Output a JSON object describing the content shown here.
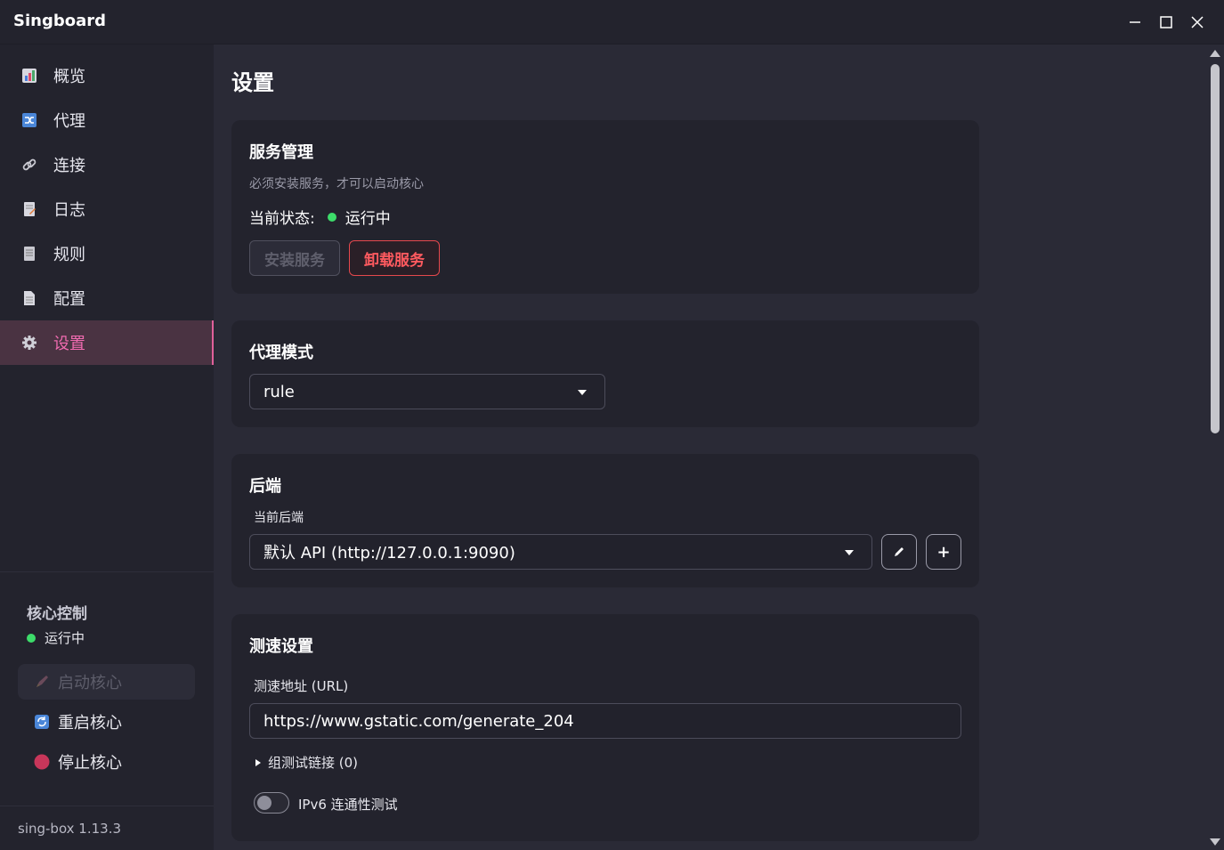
{
  "app": {
    "title": "Singboard"
  },
  "sidebar": {
    "items": [
      {
        "label": "概览",
        "icon": "chart-icon"
      },
      {
        "label": "代理",
        "icon": "shuffle-icon"
      },
      {
        "label": "连接",
        "icon": "link-icon"
      },
      {
        "label": "日志",
        "icon": "log-icon"
      },
      {
        "label": "规则",
        "icon": "rules-icon"
      },
      {
        "label": "配置",
        "icon": "document-icon"
      },
      {
        "label": "设置",
        "icon": "gear-icon",
        "active": true
      }
    ],
    "core": {
      "title": "核心控制",
      "status": "运行中",
      "start_label": "启动核心",
      "restart_label": "重启核心",
      "stop_label": "停止核心"
    },
    "version": "sing-box 1.13.3"
  },
  "main": {
    "title": "设置",
    "service": {
      "title": "服务管理",
      "hint": "必须安装服务，才可以启动核心",
      "status_label": "当前状态:",
      "status_value": "运行中",
      "install_label": "安装服务",
      "uninstall_label": "卸载服务"
    },
    "proxy_mode": {
      "title": "代理模式",
      "selected": "rule"
    },
    "backend": {
      "title": "后端",
      "current_label": "当前后端",
      "selected": "默认 API (http://127.0.0.1:9090)",
      "edit_icon": "pencil-icon",
      "add_label": "+"
    },
    "speedtest": {
      "title": "测速设置",
      "url_label": "测速地址 (URL)",
      "url_value": "https://www.gstatic.com/generate_204",
      "group_links": "组测试链接 (0)",
      "ipv6_label": "IPv6 连通性测试",
      "ipv6_enabled": false
    }
  },
  "colors": {
    "accent": "#f06bb0",
    "danger": "#ff5a5f",
    "success": "#3ddc6a"
  }
}
